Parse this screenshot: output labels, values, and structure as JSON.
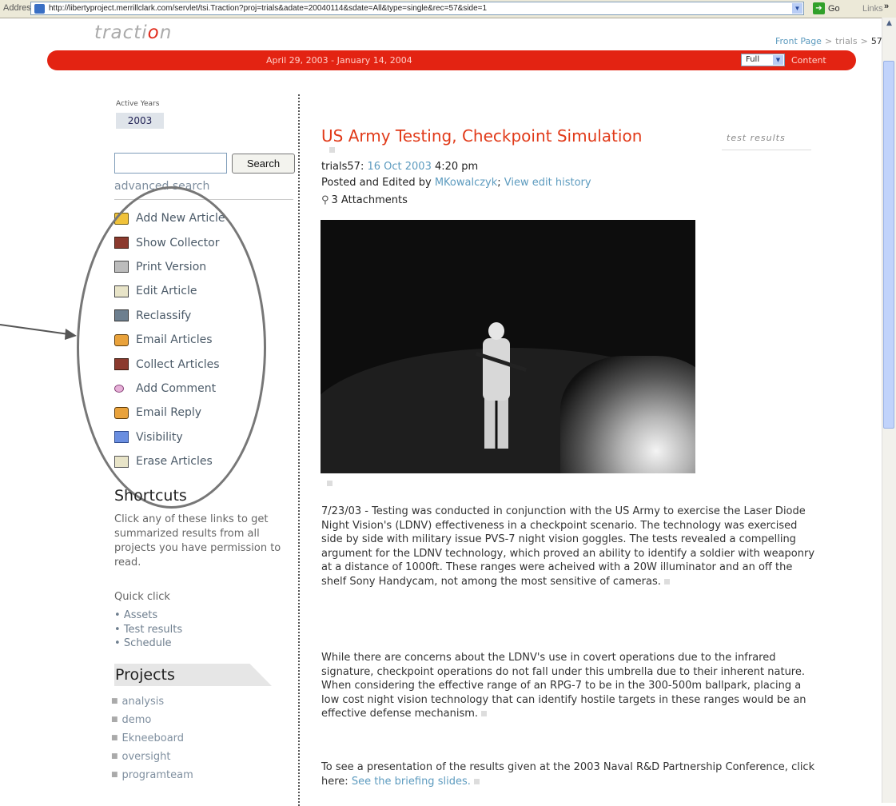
{
  "browser": {
    "address_label": "Address",
    "url": "http://libertyproject.merrillclark.com/servlet/tsi.Traction?proj=trials&adate=20040114&sdate=All&type=single&rec=57&side=1",
    "go_label": "Go",
    "links_label": "Links",
    "more_label": "»"
  },
  "header": {
    "logo_a": "tracti",
    "logo_b": "o",
    "logo_c": "n",
    "breadcrumb": [
      "Front Page",
      "trials",
      "57"
    ],
    "breadcrumb_sep": ">",
    "date_range": "April 29, 2003 - January 14, 2004",
    "view_select": "Full",
    "content_label": "Content"
  },
  "sidebar": {
    "active_years_label": "Active Years",
    "active_year": "2003",
    "search_button": "Search",
    "search_value": "",
    "advanced_search": "advanced search",
    "actions": [
      {
        "label": "Add New Article",
        "icon": "add-article-icon"
      },
      {
        "label": "Show Collector",
        "icon": "collector-icon"
      },
      {
        "label": "Print Version",
        "icon": "printer-icon"
      },
      {
        "label": "Edit Article",
        "icon": "edit-icon"
      },
      {
        "label": "Reclassify",
        "icon": "reclassify-icon"
      },
      {
        "label": "Email Articles",
        "icon": "email-icon"
      },
      {
        "label": "Collect Articles",
        "icon": "collect-icon"
      },
      {
        "label": "Add Comment",
        "icon": "comment-icon"
      },
      {
        "label": "Email Reply",
        "icon": "email-reply-icon"
      },
      {
        "label": "Visibility",
        "icon": "visibility-icon"
      },
      {
        "label": "Erase Articles",
        "icon": "erase-icon"
      }
    ],
    "shortcuts_title": "Shortcuts",
    "shortcuts_text": "Click any of these links to get summarized results from all projects you have permission to read.",
    "quick_click": "Quick click",
    "quick_links": [
      "Assets",
      "Test results",
      "Schedule"
    ],
    "projects_title": "Projects",
    "projects": [
      "analysis",
      "demo",
      "Ekneeboard",
      "oversight",
      "programteam"
    ]
  },
  "article": {
    "title": "US Army Testing, Checkpoint Simulation",
    "tag": "test results",
    "id_label": "trials57:",
    "date": "16 Oct 2003",
    "time": "4:20 pm",
    "posted_prefix": "Posted and Edited by",
    "author": "MKowalczyk",
    "history_link": "View edit history",
    "attachments": "3 Attachments",
    "para1": "7/23/03 - Testing was conducted in conjunction with the US Army to exercise the Laser Diode Night Vision's (LDNV) effectiveness in a checkpoint scenario. The technology was exercised side by side with military issue PVS-7 night vision goggles. The tests revealed a compelling argument for the LDNV technology, which proved an ability to identify a soldier with weaponry at a distance of 1000ft. These ranges were acheived with a 20W illuminator and an off the shelf Sony Handycam, not among the most sensitive of cameras.",
    "para2": "While there are concerns about the LDNV's use in covert operations due to the infrared signature, checkpoint operations do not fall under this umbrella due to their inherent nature. When considering the effective range of an RPG-7 to be in the 300-500m ballpark, placing a low cost night vision technology that can identify hostile targets in these ranges would be an effective defense mechanism.",
    "para3_prefix": "To see a presentation of the results given at the 2003 Naval R&D Partnership Conference, click here:",
    "para3_link": "See the briefing slides."
  }
}
